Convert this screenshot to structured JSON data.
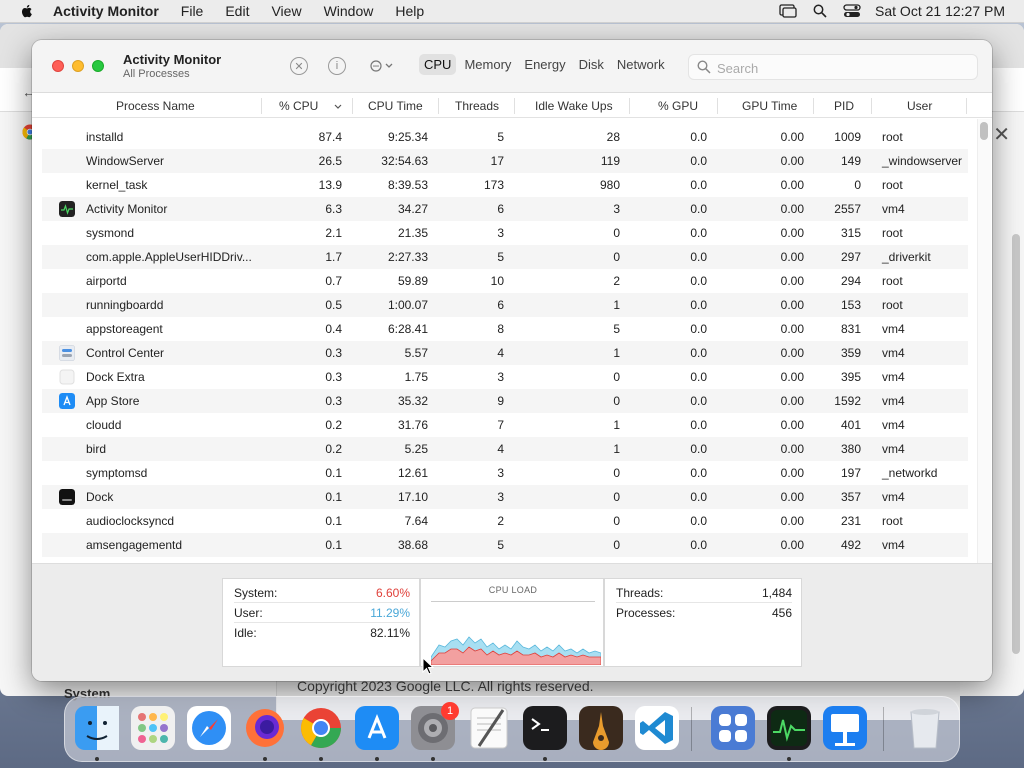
{
  "menubar": {
    "app_name": "Activity Monitor",
    "menus": [
      "File",
      "Edit",
      "View",
      "Window",
      "Help"
    ],
    "clock": "Sat Oct 21  12:27 PM"
  },
  "background_window": {
    "footer_text": "Copyright 2023 Google LLC. All rights reserved.",
    "sidebar_label": "System"
  },
  "window": {
    "title": "Activity Monitor",
    "subtitle": "All Processes",
    "tabs": [
      "CPU",
      "Memory",
      "Energy",
      "Disk",
      "Network"
    ],
    "active_tab": "CPU",
    "search_placeholder": "Search"
  },
  "table": {
    "columns": [
      "Process Name",
      "% CPU",
      "CPU Time",
      "Threads",
      "Idle Wake Ups",
      "% GPU",
      "GPU Time",
      "PID",
      "User"
    ],
    "sort_column": "% CPU",
    "rows": [
      {
        "name": "installd",
        "cpu": "87.4",
        "cpu_time": "9:25.34",
        "threads": "5",
        "idle": "28",
        "gpu": "0.0",
        "gpu_time": "0.00",
        "pid": "1009",
        "user": "root",
        "icon": ""
      },
      {
        "name": "WindowServer",
        "cpu": "26.5",
        "cpu_time": "32:54.63",
        "threads": "17",
        "idle": "119",
        "gpu": "0.0",
        "gpu_time": "0.00",
        "pid": "149",
        "user": "_windowserver",
        "icon": ""
      },
      {
        "name": "kernel_task",
        "cpu": "13.9",
        "cpu_time": "8:39.53",
        "threads": "173",
        "idle": "980",
        "gpu": "0.0",
        "gpu_time": "0.00",
        "pid": "0",
        "user": "root",
        "icon": ""
      },
      {
        "name": "Activity Monitor",
        "cpu": "6.3",
        "cpu_time": "34.27",
        "threads": "6",
        "idle": "3",
        "gpu": "0.0",
        "gpu_time": "0.00",
        "pid": "2557",
        "user": "vm4",
        "icon": "activity-monitor-icon"
      },
      {
        "name": "sysmond",
        "cpu": "2.1",
        "cpu_time": "21.35",
        "threads": "3",
        "idle": "0",
        "gpu": "0.0",
        "gpu_time": "0.00",
        "pid": "315",
        "user": "root",
        "icon": ""
      },
      {
        "name": "com.apple.AppleUserHIDDriv...",
        "cpu": "1.7",
        "cpu_time": "2:27.33",
        "threads": "5",
        "idle": "0",
        "gpu": "0.0",
        "gpu_time": "0.00",
        "pid": "297",
        "user": "_driverkit",
        "icon": ""
      },
      {
        "name": "airportd",
        "cpu": "0.7",
        "cpu_time": "59.89",
        "threads": "10",
        "idle": "2",
        "gpu": "0.0",
        "gpu_time": "0.00",
        "pid": "294",
        "user": "root",
        "icon": ""
      },
      {
        "name": "runningboardd",
        "cpu": "0.5",
        "cpu_time": "1:00.07",
        "threads": "6",
        "idle": "1",
        "gpu": "0.0",
        "gpu_time": "0.00",
        "pid": "153",
        "user": "root",
        "icon": ""
      },
      {
        "name": "appstoreagent",
        "cpu": "0.4",
        "cpu_time": "6:28.41",
        "threads": "8",
        "idle": "5",
        "gpu": "0.0",
        "gpu_time": "0.00",
        "pid": "831",
        "user": "vm4",
        "icon": ""
      },
      {
        "name": "Control Center",
        "cpu": "0.3",
        "cpu_time": "5.57",
        "threads": "4",
        "idle": "1",
        "gpu": "0.0",
        "gpu_time": "0.00",
        "pid": "359",
        "user": "vm4",
        "icon": "control-center-icon"
      },
      {
        "name": "Dock Extra",
        "cpu": "0.3",
        "cpu_time": "1.75",
        "threads": "3",
        "idle": "0",
        "gpu": "0.0",
        "gpu_time": "0.00",
        "pid": "395",
        "user": "vm4",
        "icon": "dock-extra-icon"
      },
      {
        "name": "App Store",
        "cpu": "0.3",
        "cpu_time": "35.32",
        "threads": "9",
        "idle": "0",
        "gpu": "0.0",
        "gpu_time": "0.00",
        "pid": "1592",
        "user": "vm4",
        "icon": "app-store-icon"
      },
      {
        "name": "cloudd",
        "cpu": "0.2",
        "cpu_time": "31.76",
        "threads": "7",
        "idle": "1",
        "gpu": "0.0",
        "gpu_time": "0.00",
        "pid": "401",
        "user": "vm4",
        "icon": ""
      },
      {
        "name": "bird",
        "cpu": "0.2",
        "cpu_time": "5.25",
        "threads": "4",
        "idle": "1",
        "gpu": "0.0",
        "gpu_time": "0.00",
        "pid": "380",
        "user": "vm4",
        "icon": ""
      },
      {
        "name": "symptomsd",
        "cpu": "0.1",
        "cpu_time": "12.61",
        "threads": "3",
        "idle": "0",
        "gpu": "0.0",
        "gpu_time": "0.00",
        "pid": "197",
        "user": "_networkd",
        "icon": ""
      },
      {
        "name": "Dock",
        "cpu": "0.1",
        "cpu_time": "17.10",
        "threads": "3",
        "idle": "0",
        "gpu": "0.0",
        "gpu_time": "0.00",
        "pid": "357",
        "user": "vm4",
        "icon": "dock-icon"
      },
      {
        "name": "audioclocksyncd",
        "cpu": "0.1",
        "cpu_time": "7.64",
        "threads": "2",
        "idle": "0",
        "gpu": "0.0",
        "gpu_time": "0.00",
        "pid": "231",
        "user": "root",
        "icon": ""
      },
      {
        "name": "amsengagementd",
        "cpu": "0.1",
        "cpu_time": "38.68",
        "threads": "5",
        "idle": "0",
        "gpu": "0.0",
        "gpu_time": "0.00",
        "pid": "492",
        "user": "vm4",
        "icon": ""
      }
    ]
  },
  "summary": {
    "system_label": "System:",
    "system_value": "6.60%",
    "user_label": "User:",
    "user_value": "11.29%",
    "idle_label": "Idle:",
    "idle_value": "82.11%",
    "cpu_load_title": "CPU LOAD",
    "threads_label": "Threads:",
    "threads_value": "1,484",
    "processes_label": "Processes:",
    "processes_value": "456"
  },
  "colors": {
    "system": "#e0403a",
    "user": "#4aa8d8",
    "accent": "#1a73e8"
  },
  "dock": {
    "items": [
      "finder-icon",
      "launchpad-icon",
      "safari-icon",
      "firefox-icon",
      "chrome-icon",
      "app-store-icon",
      "system-settings-icon",
      "textedit-icon",
      "terminal-icon",
      "garageband-icon",
      "vscode-icon",
      "widgets-icon",
      "activity-monitor-icon",
      "keynote-icon",
      "trash-icon"
    ],
    "settings_badge": "1"
  }
}
